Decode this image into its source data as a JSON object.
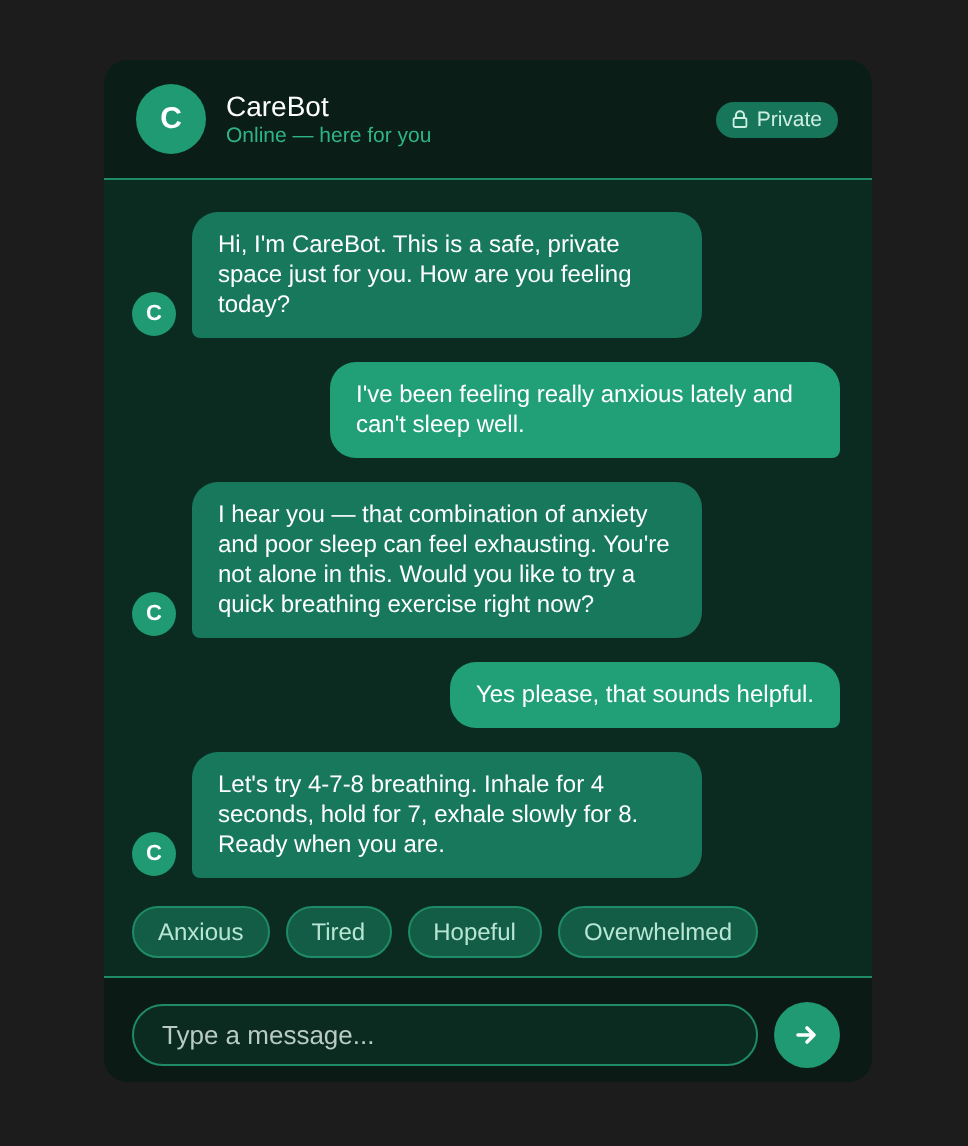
{
  "header": {
    "avatar": "C",
    "title": "CareBot",
    "status": "Online — here for you",
    "badge": "Private"
  },
  "messages": [
    {
      "kind": "bot",
      "avatar": "C",
      "text": "Hi, I'm CareBot. This is a safe, private space just for you. How are you feeling today?"
    },
    {
      "kind": "user",
      "text": "I've been feeling really anxious lately and can't sleep well."
    },
    {
      "kind": "bot",
      "avatar": "C",
      "text": "I hear you — that combination of anxiety and poor sleep can feel exhausting. You're not alone in this. Would you like to try a quick breathing exercise right now?"
    },
    {
      "kind": "user",
      "text": "Yes please, that sounds helpful."
    },
    {
      "kind": "bot",
      "avatar": "C",
      "text": "Let's try 4-7-8 breathing. Inhale for 4 seconds, hold for 7, exhale slowly for 8. Ready when you are."
    }
  ],
  "quick_replies": [
    "Anxious",
    "Tired",
    "Hopeful",
    "Overwhelmed"
  ],
  "composer": {
    "placeholder": "Type a message..."
  }
}
